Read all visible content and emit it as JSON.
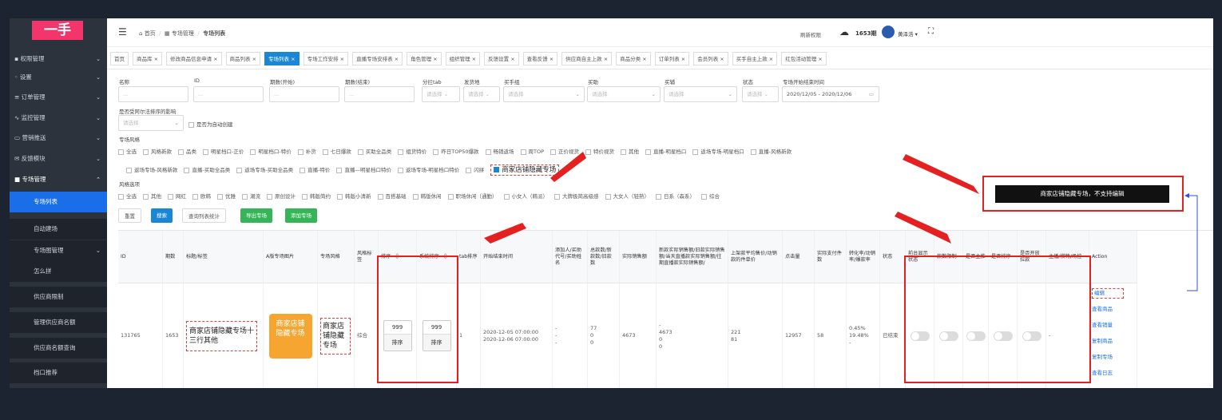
{
  "logo": "一手",
  "sidebar": {
    "items": [
      {
        "label": "权限管理",
        "icon": "lock-icon",
        "chev": "⌄"
      },
      {
        "label": "设置",
        "icon": "gear-icon",
        "chev": "⌄"
      },
      {
        "label": "订单管理",
        "icon": "list-icon",
        "chev": "⌄"
      },
      {
        "label": "监控管理",
        "icon": "pulse-icon",
        "chev": "⌄"
      },
      {
        "label": "营销推送",
        "icon": "card-icon",
        "chev": "⌄"
      },
      {
        "label": "反馈模块",
        "icon": "mail-icon",
        "chev": "⌄"
      },
      {
        "label": "专场管理",
        "icon": "square-icon",
        "chev": "⌃"
      }
    ],
    "subitems": [
      "专场列表",
      "自动建场",
      "专场图管理",
      "怎么拼",
      "供应商限制",
      "管理供应商名额",
      "供应商名额查询",
      "档口推荐"
    ],
    "subitem_chev": "⌄"
  },
  "topbar": {
    "menu_icon": "☰",
    "home_icon": "⌂",
    "breadcrumb": [
      "首页",
      "专场管理",
      "专场列表"
    ],
    "breadcrumb_icon": "▦",
    "refresh": "刷新权限",
    "cloud_icon": "☁",
    "period": "1653期",
    "user": "黄泽浩 ▾",
    "fullscreen_icon": "⛶"
  },
  "tabs": [
    "首页",
    "商品库 ×",
    "修改商品信息申请 ×",
    "商品列表 ×",
    "专场列表 ×",
    "专场工作安排 ×",
    "直播专场安排表 ×",
    "角色管理 ×",
    "组织管理 ×",
    "反馈设置 ×",
    "查看反馈 ×",
    "供应商自主上款 ×",
    "商品分类 ×",
    "订单列表 ×",
    "会员列表 ×",
    "买手自主上款 ×",
    "红包活动管理 ×"
  ],
  "filters": {
    "labels": [
      "名称",
      "ID",
      "期数(开始)",
      "期数(结束)",
      "分拦tab",
      "发货地",
      "买手组",
      "买助",
      "买辅",
      "状态",
      "专场开始结束时间"
    ],
    "placeholders": [
      "...",
      "...",
      "...",
      "...",
      "请选择 ⌄",
      "请选择 ⌄",
      "请选择",
      "请选择",
      "请选择",
      "请选择 ⌄"
    ],
    "date_range": "2020/12/05 - 2020/12/06",
    "calendar_icon": "▭",
    "arrange_label": "是否受阿尔法排序的影响",
    "arrange_placeholder": "请选择",
    "arrange_chevron": "⌄",
    "auto_create": "是否为自动创建"
  },
  "style_section": {
    "title": "专场风格",
    "row1": [
      "全选",
      "风格新款",
      "品类",
      "明星档口-正价",
      "明星档口-特价",
      "补货",
      "七日爆款",
      "买助全品类",
      "组货特价",
      "昨日TOP50爆款",
      "畅销返场",
      "周TOP",
      "正价视货",
      "特价视货",
      "其他",
      "直播-明星档口",
      "返场专场-明星档口",
      "直播-风格新款"
    ],
    "row2": [
      "返场专场-风格新款",
      "直播-买助全品类",
      "返场专场-买助全品类",
      "直播-特价",
      "直播—明星档口特价",
      "返场专场-明星档口特价",
      "闪拼"
    ],
    "row2_checked": "商家店铺隐藏专场"
  },
  "style_options": {
    "title": "风格选项",
    "items": [
      "全选",
      "其他",
      "网红",
      "欧韩",
      "优雅",
      "潮流",
      "原创设计",
      "韩版简约",
      "韩版小清新",
      "百搭基础",
      "韩版休闲",
      "职场休闲（通勤）",
      "小女人（韩派）",
      "大牌极简高级感",
      "大女人（轻熟）",
      "日系（森系）",
      "综合"
    ]
  },
  "buttons": {
    "reset": "重置",
    "search": "搜索",
    "stats": "查询列表统计",
    "export": "导出专场",
    "add": "添加专场"
  },
  "tooltip": "商家店铺隐藏专场，不支持编辑",
  "table": {
    "headers": [
      "ID",
      "期数",
      "标题/标签",
      "A版专场图片",
      "专场风格",
      "风格标签",
      "排序",
      "系统排序",
      "tab排序",
      "开始结束时间",
      "添加人/买助代号/买助姓名",
      "总款数/新款数/旧款数",
      "实际销售额",
      "新款实际销售额/旧款实际销售额/当天直播款实际销售额/往期直播款实际销售额/",
      "上架款平均售价/动销款的件单价",
      "点击量",
      "实际支付件数",
      "转化率/动销率/爆款率",
      "状态",
      "前台显示状态",
      "款数限制",
      "是否主推",
      "是否排序",
      "是否开放拉款",
      "主播/模特/场控",
      "Action"
    ],
    "sort_icon": "⇕",
    "row": {
      "id": "131765",
      "period": "1653",
      "title": "商家店铺隐藏专场十三行其他",
      "image_text": "商家店铺隐藏专场",
      "style": "商家店铺隐藏专场",
      "style_tag": "综合",
      "sort_value": "999",
      "sort_btn": "排序",
      "sys_sort_value": "999",
      "sys_sort_btn": "排序",
      "tab_sort": "1",
      "start": "2020-12-05 07:00:00",
      "end": "2020-12-06 07:00:00",
      "adder": [
        "-",
        "-",
        "-"
      ],
      "counts": [
        "77",
        "0",
        "0"
      ],
      "sales": "4673",
      "sales_detail": [
        "-",
        "4673",
        "0",
        "0"
      ],
      "prices": [
        "221",
        "81"
      ],
      "clicks": "12957",
      "paid": "58",
      "rates": [
        "0.45%",
        "19.48%",
        "-"
      ],
      "status": "已结束",
      "anchor": "-",
      "actions": [
        "编辑",
        "查看商品",
        "查看销量",
        "复制商品",
        "复制专场",
        "查看日志"
      ]
    }
  },
  "colors": {
    "sidebar_bg": "#2c333d",
    "active_blue": "#1a6fe8",
    "tab_active": "#1a87d6",
    "highlight_red": "#e52020",
    "image_orange": "#f7a531",
    "button_green": "#35b558",
    "logo_pink": "#f2366b"
  }
}
